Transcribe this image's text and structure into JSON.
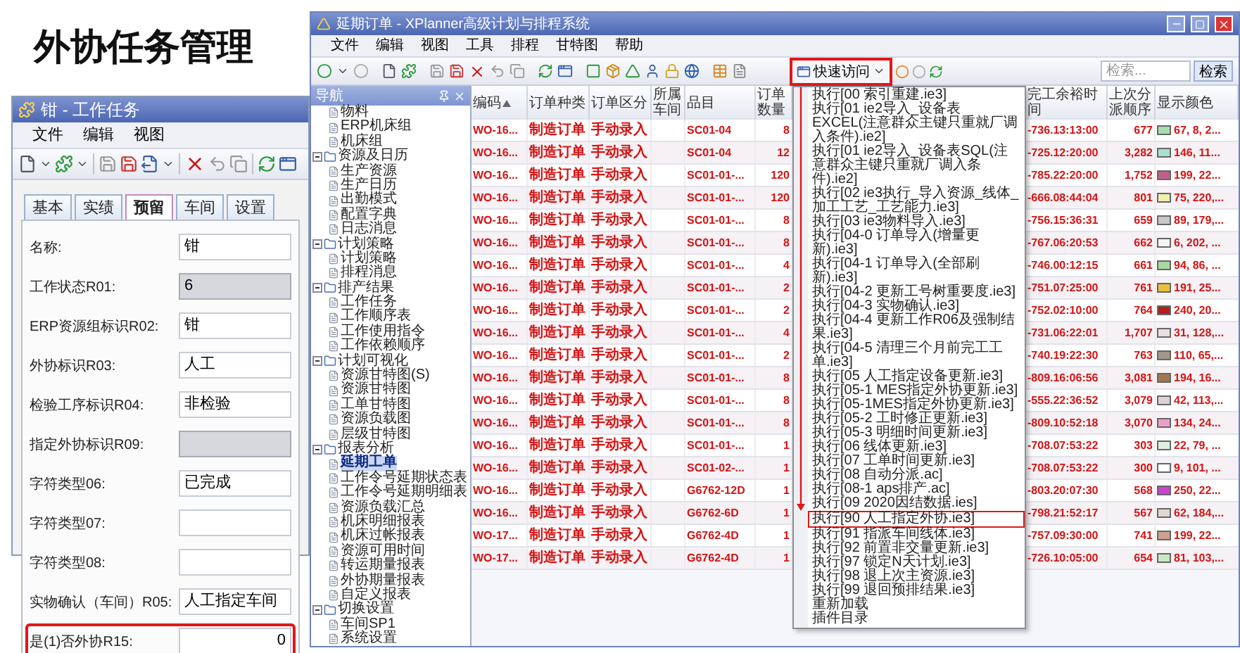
{
  "page_title": "外协任务管理",
  "task_window": {
    "title": "钳 - 工作任务",
    "menu": [
      "文件",
      "编辑",
      "视图"
    ],
    "tabs": [
      {
        "label": "基本",
        "selected": false
      },
      {
        "label": "实绩",
        "selected": false
      },
      {
        "label": "预留",
        "selected": true
      },
      {
        "label": "车间",
        "selected": false
      },
      {
        "label": "设置",
        "selected": false
      }
    ],
    "fields": [
      {
        "label": "名称:",
        "value": "钳",
        "readonly": false,
        "kind": "text",
        "highlighted": false
      },
      {
        "label": "工作状态R01:",
        "value": "6",
        "readonly": true,
        "kind": "text",
        "highlighted": false
      },
      {
        "label": "ERP资源组标识R02:",
        "value": "钳",
        "readonly": false,
        "kind": "text",
        "highlighted": false
      },
      {
        "label": "外协标识R03:",
        "value": "人工",
        "readonly": false,
        "kind": "text",
        "highlighted": false
      },
      {
        "label": "检验工序标识R04:",
        "value": "非检验",
        "readonly": false,
        "kind": "text",
        "highlighted": false
      },
      {
        "label": "指定外协标识R09:",
        "readonly": true,
        "kind": "text",
        "highlighted": false
      },
      {
        "label": "字符类型06:",
        "value": "已完成",
        "readonly": false,
        "kind": "text",
        "highlighted": false
      },
      {
        "label": "字符类型07:",
        "readonly": false,
        "kind": "text",
        "highlighted": false
      },
      {
        "label": "字符类型08:",
        "readonly": false,
        "kind": "text",
        "highlighted": false
      },
      {
        "label": "实物确认（车间）R05:",
        "value": "人工指定车间",
        "readonly": false,
        "kind": "text",
        "highlighted": false
      },
      {
        "label": "是(1)否外协R15:",
        "value": "0",
        "readonly": false,
        "kind": "number",
        "highlighted": true
      }
    ]
  },
  "planner_window": {
    "title": "延期订单 - XPlanner高级计划与排程系统",
    "menu": [
      "文件",
      "编辑",
      "视图",
      "工具",
      "排程",
      "甘特图",
      "帮助"
    ],
    "quick_access": {
      "label": "快速访问",
      "highlighted": true
    },
    "search": {
      "placeholder": "检索...",
      "button": "检索"
    },
    "nav": {
      "title": "导航",
      "tree": [
        {
          "label": "物料",
          "selected": false
        },
        {
          "label": "ERP机床组",
          "selected": false
        },
        {
          "label": "机床组",
          "selected": false
        },
        {
          "label": "资源及日历",
          "selected": false,
          "children": [
            {
              "label": "生产资源",
              "selected": false
            },
            {
              "label": "生产日历",
              "selected": false
            },
            {
              "label": "出勤模式",
              "selected": false
            },
            {
              "label": "配置字典",
              "selected": false
            },
            {
              "label": "日志消息",
              "selected": false
            }
          ]
        },
        {
          "label": "计划策略",
          "selected": false,
          "children": [
            {
              "label": "计划策略",
              "selected": false
            },
            {
              "label": "排程消息",
              "selected": false
            }
          ]
        },
        {
          "label": "排产结果",
          "selected": false,
          "children": [
            {
              "label": "工作任务",
              "selected": false
            },
            {
              "label": "工作顺序表",
              "selected": false
            },
            {
              "label": "工作使用指令",
              "selected": false
            },
            {
              "label": "工作依赖顺序",
              "selected": false
            }
          ]
        },
        {
          "label": "计划可视化",
          "selected": false,
          "children": [
            {
              "label": "资源甘特图(S)",
              "selected": false
            },
            {
              "label": "资源甘特图",
              "selected": false
            },
            {
              "label": "工单甘特图",
              "selected": false
            },
            {
              "label": "资源负载图",
              "selected": false
            },
            {
              "label": "层级甘特图",
              "selected": false
            }
          ]
        },
        {
          "label": "报表分析",
          "selected": false,
          "children": [
            {
              "label": "延期工单",
              "selected": true
            },
            {
              "label": "工作令号延期状态表",
              "selected": false
            },
            {
              "label": "工作令号延期明细表",
              "selected": false
            },
            {
              "label": "资源负载汇总",
              "selected": false
            },
            {
              "label": "机床明细报表",
              "selected": false
            },
            {
              "label": "机床过帐报表",
              "selected": false
            },
            {
              "label": "资源可用时间",
              "selected": false
            },
            {
              "label": "转运期量报表",
              "selected": false
            },
            {
              "label": "外协期量报表",
              "selected": false
            },
            {
              "label": "自定义报表",
              "selected": false
            }
          ]
        },
        {
          "label": "切换设置",
          "selected": false,
          "children": [
            {
              "label": "车间SP1",
              "selected": false
            }
          ]
        },
        {
          "label": "系统设置",
          "selected": false
        }
      ]
    },
    "grid": {
      "columns_left": [
        "编码",
        "订单种类",
        "订单区分",
        "所属车间",
        "品目",
        "订单数量"
      ],
      "columns_right": [
        "完工余裕时间",
        "上次分派顺序",
        "显示颜色"
      ],
      "rows": [
        {
          "code": "WO-16...",
          "order_type": "制造订单",
          "order_source": "手动录入",
          "item": "SC01-04",
          "quantity": "8",
          "slack": "-736.13:13:00",
          "last_seq": "677",
          "color": "#a8dcb0",
          "color_label": "67, 8, 2..."
        },
        {
          "code": "WO-16...",
          "order_type": "制造订单",
          "order_source": "手动录入",
          "item": "SC01-04",
          "quantity": "12",
          "slack": "-725.12:20:00",
          "last_seq": "3,282",
          "color": "#a8e0d0",
          "color_label": "146, 11..."
        },
        {
          "code": "WO-16...",
          "order_type": "制造订单",
          "order_source": "手动录入",
          "item": "SC01-01-...",
          "quantity": "120",
          "slack": "-785.22:20:00",
          "last_seq": "1,752",
          "color": "#c0608a",
          "color_label": "199, 22..."
        },
        {
          "code": "WO-16...",
          "order_type": "制造订单",
          "order_source": "手动录入",
          "item": "SC01-01-...",
          "quantity": "120",
          "slack": "-666.08:44:04",
          "last_seq": "801",
          "color": "#f0f0b0",
          "color_label": "75, 220,..."
        },
        {
          "code": "WO-16...",
          "order_type": "制造订单",
          "order_source": "手动录入",
          "item": "SC01-01-...",
          "quantity": "8",
          "slack": "-756.15:36:31",
          "last_seq": "659",
          "color": "#c8c8c8",
          "color_label": "89, 179,..."
        },
        {
          "code": "WO-16...",
          "order_type": "制造订单",
          "order_source": "手动录入",
          "item": "SC01-01-...",
          "quantity": "8",
          "slack": "-767.06:20:53",
          "last_seq": "662",
          "color": "#f4f4f4",
          "color_label": "6, 202, ..."
        },
        {
          "code": "WO-16...",
          "order_type": "制造订单",
          "order_source": "手动录入",
          "item": "SC01-01-...",
          "quantity": "4",
          "slack": "-746.00:12:15",
          "last_seq": "661",
          "color": "#a8d8a0",
          "color_label": "94, 86, ..."
        },
        {
          "code": "WO-16...",
          "order_type": "制造订单",
          "order_source": "手动录入",
          "item": "SC01-01-...",
          "quantity": "2",
          "slack": "-751.07:25:00",
          "last_seq": "761",
          "color": "#e8c040",
          "color_label": "191, 25..."
        },
        {
          "code": "WO-16...",
          "order_type": "制造订单",
          "order_source": "手动录入",
          "item": "SC01-01-...",
          "quantity": "2",
          "slack": "-752.02:10:00",
          "last_seq": "764",
          "color": "#b02020",
          "color_label": "240, 20..."
        },
        {
          "code": "WO-16...",
          "order_type": "制造订单",
          "order_source": "手动录入",
          "item": "SC01-01-...",
          "quantity": "4",
          "slack": "-731.06:22:01",
          "last_seq": "1,707",
          "color": "#e8e0e0",
          "color_label": "31, 128,..."
        },
        {
          "code": "WO-16...",
          "order_type": "制造订单",
          "order_source": "手动录入",
          "item": "SC01-01-...",
          "quantity": "2",
          "slack": "-740.19:22:30",
          "last_seq": "763",
          "color": "#a09888",
          "color_label": "110, 65,..."
        },
        {
          "code": "WO-16...",
          "order_type": "制造订单",
          "order_source": "手动录入",
          "item": "SC01-01-...",
          "quantity": "8",
          "slack": "-809.16:06:56",
          "last_seq": "3,081",
          "color": "#a07850",
          "color_label": "194, 16..."
        },
        {
          "code": "WO-16...",
          "order_type": "制造订单",
          "order_source": "手动录入",
          "item": "SC01-01-...",
          "quantity": "8",
          "slack": "-555.22:36:52",
          "last_seq": "3,079",
          "color": "#e0d0d8",
          "color_label": "42, 113,..."
        },
        {
          "code": "WO-16...",
          "order_type": "制造订单",
          "order_source": "手动录入",
          "item": "SC01-01-...",
          "quantity": "8",
          "slack": "-809.10:52:18",
          "last_seq": "3,070",
          "color": "#e8a0c8",
          "color_label": "134, 24..."
        },
        {
          "code": "WO-16...",
          "order_type": "制造订单",
          "order_source": "手动录入",
          "item": "SC01-01-...",
          "quantity": "1",
          "slack": "-708.07:53:22",
          "last_seq": "303",
          "color": "#e0f0e0",
          "color_label": "22, 79, ..."
        },
        {
          "code": "WO-16...",
          "order_type": "制造订单",
          "order_source": "手动录入",
          "item": "SC01-02-...",
          "quantity": "1",
          "slack": "-708.07:53:22",
          "last_seq": "300",
          "color": "#ffffff",
          "color_label": "9, 101, ..."
        },
        {
          "code": "WO-16...",
          "order_type": "制造订单",
          "order_source": "手动录入",
          "item": "G6762-12D",
          "quantity": "1",
          "slack": "-803.20:07:30",
          "last_seq": "568",
          "color": "#d040d0",
          "color_label": "250, 22..."
        },
        {
          "code": "WO-16...",
          "order_type": "制造订单",
          "order_source": "手动录入",
          "item": "G6762-6D",
          "quantity": "1",
          "slack": "-798.21:52:17",
          "last_seq": "567",
          "color": "#e0d8d0",
          "color_label": "62, 184,..."
        },
        {
          "code": "WO-17...",
          "order_type": "制造订单",
          "order_source": "手动录入",
          "item": "G6762-4D",
          "quantity": "1",
          "slack": "-757.09:30:00",
          "last_seq": "741",
          "color": "#d0a090",
          "color_label": "199, 22..."
        },
        {
          "code": "WO-17...",
          "order_type": "制造订单",
          "order_source": "手动录入",
          "item": "G6762-4D",
          "quantity": "1",
          "slack": "-726.10:05:00",
          "last_seq": "654",
          "color": "#c8e8c0",
          "color_label": "81, 103,..."
        }
      ]
    },
    "quick_menu": {
      "items": [
        {
          "label": "执行[00 索引重建.ie3]",
          "highlighted": false
        },
        {
          "label": "执行[01 ie2导入_设备表EXCEL(注意群众主键只重就厂调入条件).ie2]",
          "highlighted": false
        },
        {
          "label": "执行[01 ie2导入_设备表SQL(注意群众主键只重就厂调入条件).ie2]",
          "highlighted": false
        },
        {
          "label": "执行[02 ie3执行_导入资源_线体_加工工艺_工艺能力.ie3]",
          "highlighted": false
        },
        {
          "label": "执行[03 ie3物料导入.ie3]",
          "highlighted": false
        },
        {
          "label": "执行[04-0 订单导入(增量更新).ie3]",
          "highlighted": false
        },
        {
          "label": "执行[04-1 订单导入(全部刷新).ie3]",
          "highlighted": false
        },
        {
          "label": "执行[04-2 更新工号树重要度.ie3]",
          "highlighted": false
        },
        {
          "label": "执行[04-3 实物确认.ie3]",
          "highlighted": false
        },
        {
          "label": "执行[04-4 更新工作R06及强制结果.ie3]",
          "highlighted": false
        },
        {
          "label": "执行[04-5 清理三个月前完工工单.ie3]",
          "highlighted": false
        },
        {
          "label": "执行[05 人工指定设备更新.ie3]",
          "highlighted": false
        },
        {
          "label": "执行[05-1 MES指定外协更新.ie3]",
          "highlighted": false
        },
        {
          "label": "执行[05-1MES指定外协更新.ie3]",
          "highlighted": false
        },
        {
          "label": "执行[05-2 工时修正更新.ie3]",
          "highlighted": false
        },
        {
          "label": "执行[05-3 明细时间更新.ie3]",
          "highlighted": false
        },
        {
          "label": "执行[06 线体更新.ie3]",
          "highlighted": false
        },
        {
          "label": "执行[07 工单时间更新.ie3]",
          "highlighted": false
        },
        {
          "label": "执行[08 自动分派.ac]",
          "highlighted": false
        },
        {
          "label": "执行[08-1 aps排产.ac]",
          "highlighted": false
        },
        {
          "label": "执行[09 2020因结数据.ies]",
          "highlighted": false
        },
        {
          "label": "执行[90 人工指定外协.ie3]",
          "highlighted": true
        },
        {
          "label": "执行[91 指派车间线体.ie3]",
          "highlighted": false
        },
        {
          "label": "执行[92 前置非交量更新.ie3]",
          "highlighted": false
        },
        {
          "label": "执行[97 锁定N天计划.ie3]",
          "highlighted": false
        },
        {
          "label": "执行[98 退上次主资源.ie3]",
          "highlighted": false
        },
        {
          "label": "执行[99 退回预排结果.ie3]",
          "highlighted": false
        },
        {
          "label": "重新加载",
          "highlighted": false
        },
        {
          "label": "插件目录",
          "highlighted": false
        }
      ]
    }
  }
}
